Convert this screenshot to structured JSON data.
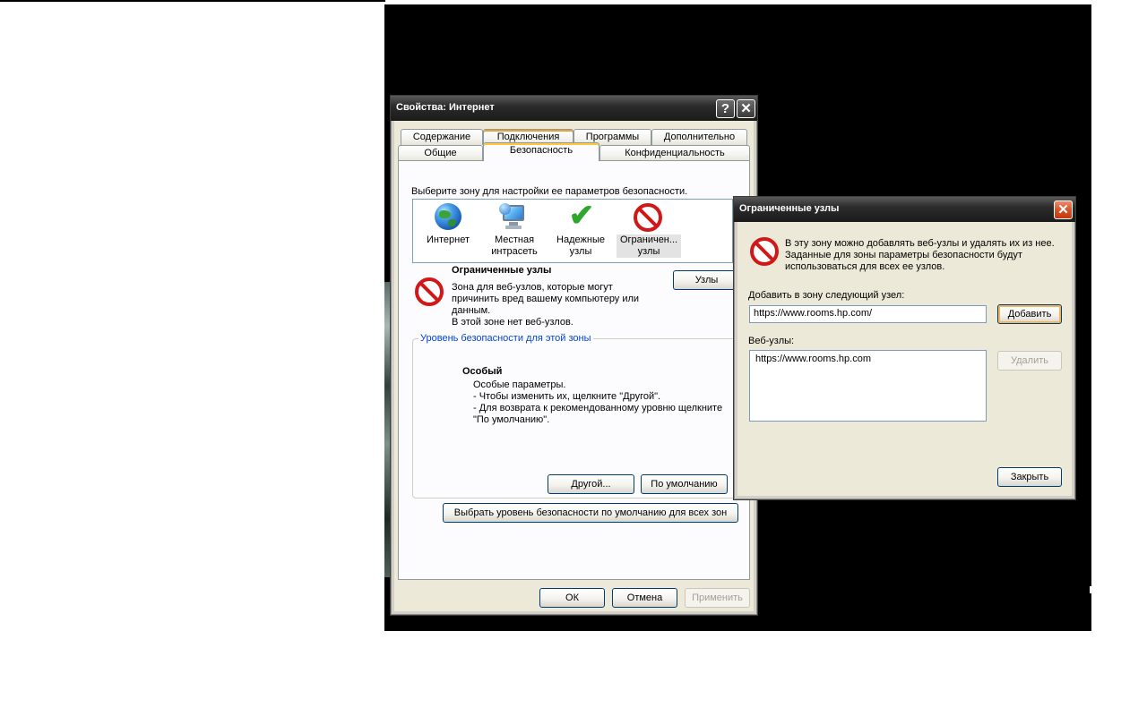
{
  "inet_dialog": {
    "title": "Свойства: Интернет",
    "help_glyph": "?",
    "close_glyph": "✕",
    "tabs_row1": [
      {
        "label": "Содержание"
      },
      {
        "label": "Подключения"
      },
      {
        "label": "Программы"
      },
      {
        "label": "Дополнительно"
      }
    ],
    "tabs_row2": [
      {
        "label": "Общие"
      },
      {
        "label": "Безопасность"
      },
      {
        "label": "Конфиденциальность"
      }
    ],
    "select_zone_text": "Выберите зону для настройки ее параметров безопасности.",
    "zones": [
      {
        "label_l1": "Интернет",
        "label_l2": "",
        "icon": "globe-icon"
      },
      {
        "label_l1": "Местная",
        "label_l2": "интрасеть",
        "icon": "local-intranet-icon"
      },
      {
        "label_l1": "Надежные",
        "label_l2": "узлы",
        "icon": "trusted-sites-icon"
      },
      {
        "label_l1": "Ограничен...",
        "label_l2": "узлы",
        "icon": "restricted-sites-icon",
        "selected": true
      }
    ],
    "zone_info": {
      "title": "Ограниченные узлы",
      "desc_l1": "Зона для веб-узлов, которые могут",
      "desc_l2": "причинить вред вашему компьютеру или",
      "desc_l3": "данным.",
      "desc_l4": "В этой зоне нет веб-узлов."
    },
    "sites_button": "Узлы",
    "security_level": {
      "legend": "Уровень безопасности для этой зоны",
      "level_name": "Особый",
      "line1": "Особые параметры.",
      "line2": "- Чтобы изменить их, щелкните \"Другой\".",
      "line3": "- Для возврата к рекомендованному уровню щелкните",
      "line4": "\"По умолчанию\".",
      "custom_button": "Другой...",
      "default_button": "По умолчанию"
    },
    "reset_all_button": "Выбрать уровень безопасности по умолчанию для всех зон",
    "ok_button": "ОК",
    "cancel_button": "Отмена",
    "apply_button": "Применить"
  },
  "restricted_dialog": {
    "title": "Ограниченные узлы",
    "close_glyph": "✕",
    "info_l1": "В эту зону можно добавлять веб-узлы и удалять их из нее.",
    "info_l2": "Заданные для зоны параметры безопасности будут",
    "info_l3": "использоваться для всех ее узлов.",
    "add_label": "Добавить в зону следующий узел:",
    "add_value": "https://www.rooms.hp.com/",
    "add_button": "Добавить",
    "sites_label": "Веб-узлы:",
    "sites": [
      "https://www.rooms.hp.com"
    ],
    "remove_button": "Удалить",
    "close_button": "Закрыть"
  },
  "colors": {
    "desktop": "#000000",
    "title_bar": "#2c2c2c",
    "dialog_face": "#ece9d8",
    "link_blue": "#0046d5",
    "restricted_red": "#d01818",
    "trusted_green": "#2da82d"
  }
}
